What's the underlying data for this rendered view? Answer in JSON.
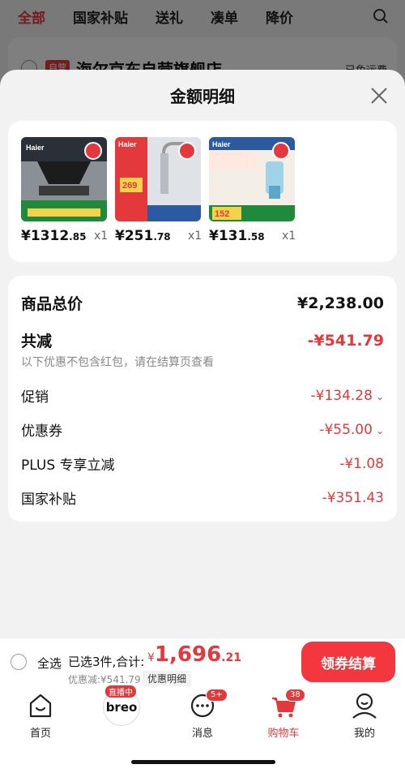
{
  "background": {
    "tabs": [
      "全部",
      "国家补贴",
      "送礼",
      "凑单",
      "降价"
    ],
    "store_badge": "自营",
    "store_name": "海尔京东自营旗舰店",
    "store_right": "已免运费"
  },
  "sheet": {
    "title": "金额明细",
    "products": [
      {
        "price_int": "¥1312",
        "price_dec": ".85",
        "qty": "x1",
        "brand": "Haier"
      },
      {
        "price_int": "¥251",
        "price_dec": ".78",
        "qty": "x1",
        "brand": "Haier"
      },
      {
        "price_int": "¥131",
        "price_dec": ".58",
        "qty": "x1",
        "brand": "Haier"
      }
    ],
    "summary": {
      "total_label": "商品总价",
      "total_value": "¥2,238.00",
      "reduce_label": "共减",
      "reduce_value": "-¥541.79",
      "note": "以下优惠不包含红包，请在结算页查看",
      "items": [
        {
          "label": "促销",
          "value": "-¥134.28"
        },
        {
          "label": "优惠券",
          "value": "-¥55.00"
        },
        {
          "label": "PLUS 专享立减",
          "value": "-¥1.08"
        },
        {
          "label": "国家补贴",
          "value": "-¥351.43"
        }
      ]
    }
  },
  "checkout": {
    "select_all": "全选",
    "selected": "已选3件,合计:",
    "currency": "¥",
    "total_int": "1,696",
    "total_dec": ".21",
    "discount": "优惠减:¥541.79",
    "detail_label": "优惠明细",
    "button": "领券结算"
  },
  "tabbar": {
    "home": "首页",
    "live_tag": "直播中",
    "live_logo": "breo",
    "messages": "消息",
    "messages_badge": "5+",
    "cart": "购物车",
    "cart_badge": "38",
    "me": "我的"
  },
  "colors": {
    "accent": "#e4393c",
    "button": "#f4373f"
  }
}
